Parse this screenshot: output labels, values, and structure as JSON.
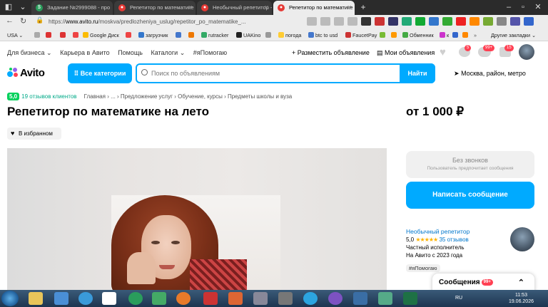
{
  "browser": {
    "tabs": [
      {
        "label": "Задание №2999088 - про",
        "active": false
      },
      {
        "label": "Репетитор по математике",
        "active": false
      },
      {
        "label": "Необычный репетитор - Е",
        "active": false
      },
      {
        "label": "Репетитор по математике",
        "active": true
      }
    ],
    "url_host": "www.avito.ru",
    "url_path": "/moskva/predlozheniya_uslug/repetitor_po_matematike_...",
    "url_scheme": "https://",
    "bookmarks": [
      "USA",
      "Google Диск",
      "загрузчик",
      "rutracker",
      "UAKino",
      "погода",
      "btc to usd",
      "FaucetPay",
      "Обменник",
      "к",
      "Другие закладки"
    ]
  },
  "avito": {
    "topnav": [
      "Для бизнеса ⌄",
      "Карьера в Авито",
      "Помощь",
      "Каталоги ⌄",
      "#яПомогаю"
    ],
    "post_ad": "+ Разместить объявление",
    "my_ads": "Мои объявления",
    "badges": {
      "notifications": "5",
      "messages": "99+",
      "cart": "15"
    },
    "logo": "Avito",
    "categories_button": "Все категории",
    "search_placeholder": "Поиск по объявлениям",
    "search_button": "Найти",
    "location": "Москва, район, метро",
    "rating": "5,0",
    "reviews_link": "19 отзывов клиентов",
    "breadcrumbs": "Главная › ... › Предложение услуг › Обучение, курсы › Предметы школы и вуза",
    "title": "Репетитор по математике на лето",
    "price": "от 1 000 ₽",
    "favorite": "В избранном",
    "no_calls_title": "Без звонков",
    "no_calls_sub": "Пользователь предпочитает сообщения",
    "write_message": "Написать сообщение",
    "seller_name": "Необычный репетитор",
    "seller_rating": "5,0",
    "seller_stars": "★★★★★",
    "seller_reviews": "35 отзывов",
    "seller_type": "Частный исполнитель",
    "seller_since": "На Авито с 2023 года",
    "tag": "#яПомогаю",
    "messages_widget": "Сообщения",
    "messages_count": "99+"
  },
  "taskbar": {
    "lang": "RU",
    "time": "11:53",
    "date": "19.06.2026"
  },
  "colors": {
    "accent": "#00aaff",
    "rating_green": "#02d15c",
    "star": "#fdb300"
  }
}
